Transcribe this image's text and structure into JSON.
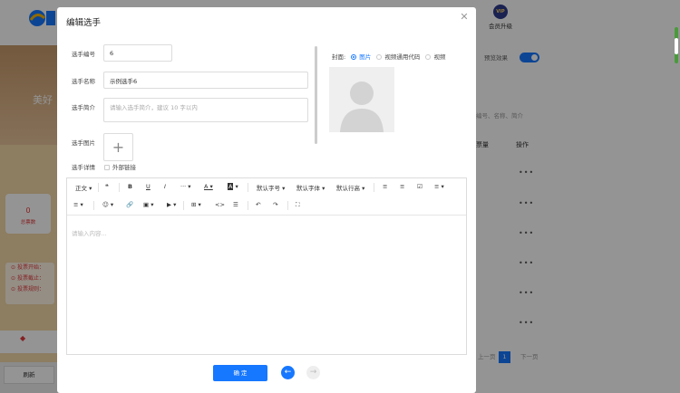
{
  "background": {
    "vip_badge": "VIP",
    "vip_label": "会员升级",
    "preview_label": "预览效果",
    "search_hint": "编号、名称、简介",
    "col_ops": "操作",
    "col_votes": "票量",
    "card_value": "0",
    "card_label": "总票数",
    "info_lines": [
      "投票开始：",
      "投票截止：",
      "投票规则："
    ],
    "phone_title": "美好",
    "refresh": "刷新",
    "row_menu": "•••",
    "pager_prev": "上一页",
    "pager_current": "1",
    "pager_next": "下一页"
  },
  "modal": {
    "title": "编辑选手",
    "close_icon": "close-icon",
    "fields": {
      "number_label": "选手编号",
      "number_value": "6",
      "name_label": "选手名称",
      "name_value": "示例选手6",
      "intro_label": "选手简介",
      "intro_placeholder": "请输入选手简介，建议 10 字以内",
      "image_label": "选手图片",
      "detail_label": "选手详情",
      "external_link_label": "外部链接"
    },
    "cover": {
      "label": "封面:",
      "options": [
        "图片",
        "视频通用代码",
        "视频"
      ],
      "selected": "图片"
    },
    "editor": {
      "toolbar_row1": [
        "正文",
        "❝",
        "B",
        "U",
        "I",
        "···",
        "A",
        "A",
        "默认字号",
        "默认字体",
        "默认行高",
        "≡",
        "≡",
        "☑",
        "≡"
      ],
      "toolbar_row2": [
        "≡",
        "☺",
        "🔗",
        "▣",
        "▶",
        "⊞",
        "<>",
        "☰",
        "↶",
        "↷",
        "⛶"
      ],
      "placeholder": "请输入内容..."
    },
    "confirm": "确 定",
    "prev_icon": "arrow-left-icon",
    "next_icon": "arrow-right-icon"
  },
  "colors": {
    "accent": "#1677ff",
    "danger": "#e4393c"
  }
}
